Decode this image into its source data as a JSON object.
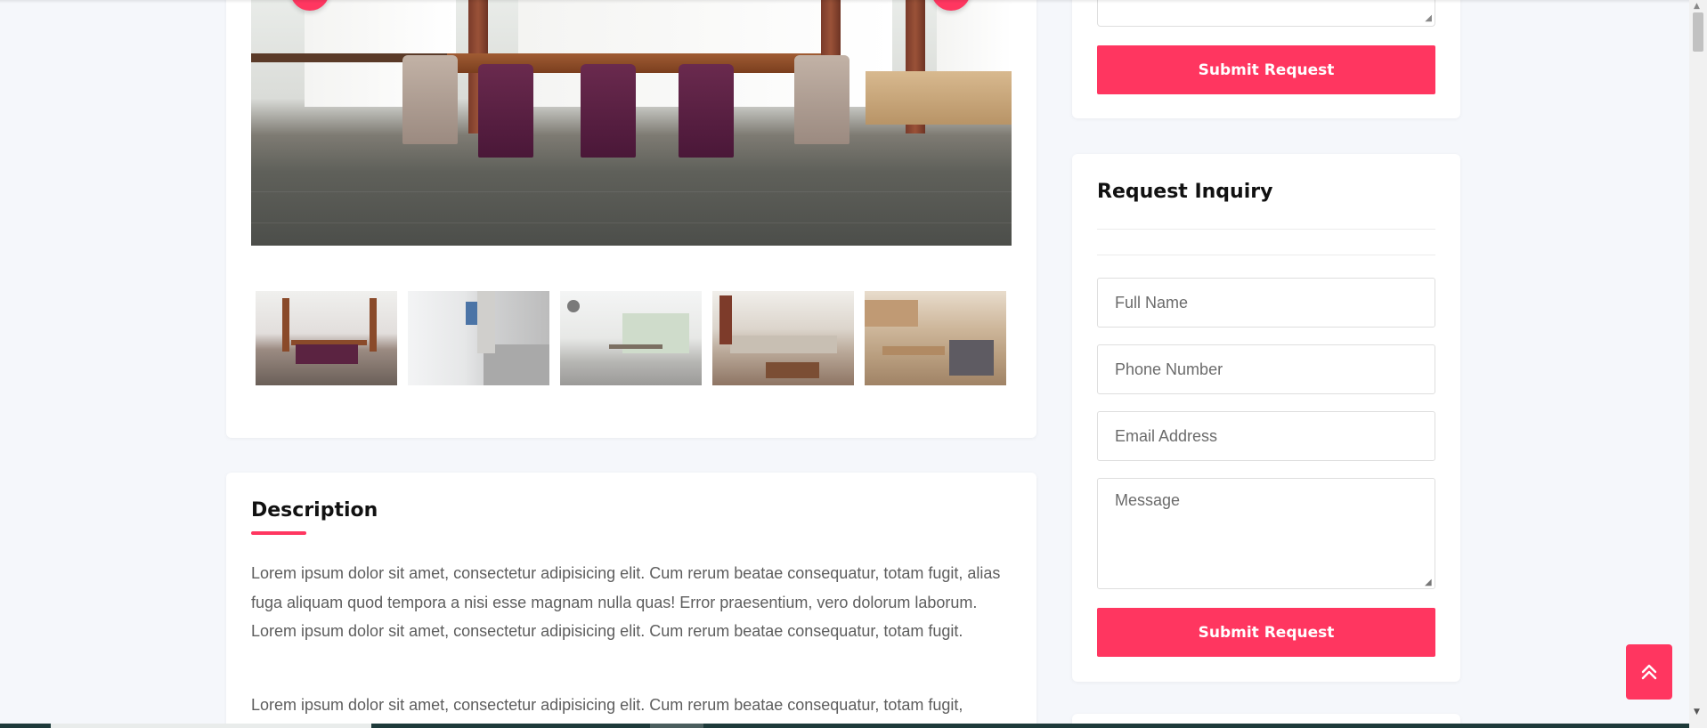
{
  "gallery": {
    "prev_icon": "chevron-left-icon",
    "next_icon": "chevron-right-icon",
    "prev_glyph": "‹",
    "next_glyph": "›",
    "thumbnails": [
      "dining-room",
      "staircase",
      "dining-patio",
      "living-room",
      "kitchen"
    ]
  },
  "description": {
    "title": "Description",
    "paragraphs": [
      "Lorem ipsum dolor sit amet, consectetur adipisicing elit. Cum rerum beatae consequatur, totam fugit, alias fuga aliquam quod tempora a nisi esse magnam nulla quas! Error praesentium, vero dolorum laborum. Lorem ipsum dolor sit amet, consectetur adipisicing elit. Cum rerum beatae consequatur, totam fugit.",
      "Lorem ipsum dolor sit amet, consectetur adipisicing elit. Cum rerum beatae consequatur, totam fugit,"
    ]
  },
  "top_form": {
    "submit_label": "Submit Request"
  },
  "inquiry": {
    "title": "Request Inquiry",
    "full_name_placeholder": "Full Name",
    "phone_placeholder": "Phone Number",
    "email_placeholder": "Email Address",
    "message_placeholder": "Message",
    "submit_label": "Submit Request"
  },
  "back_to_top": {
    "icon": "double-chevron-up-icon"
  },
  "colors": {
    "accent": "#ff3660",
    "background": "#f5f7fb",
    "card": "#ffffff"
  }
}
